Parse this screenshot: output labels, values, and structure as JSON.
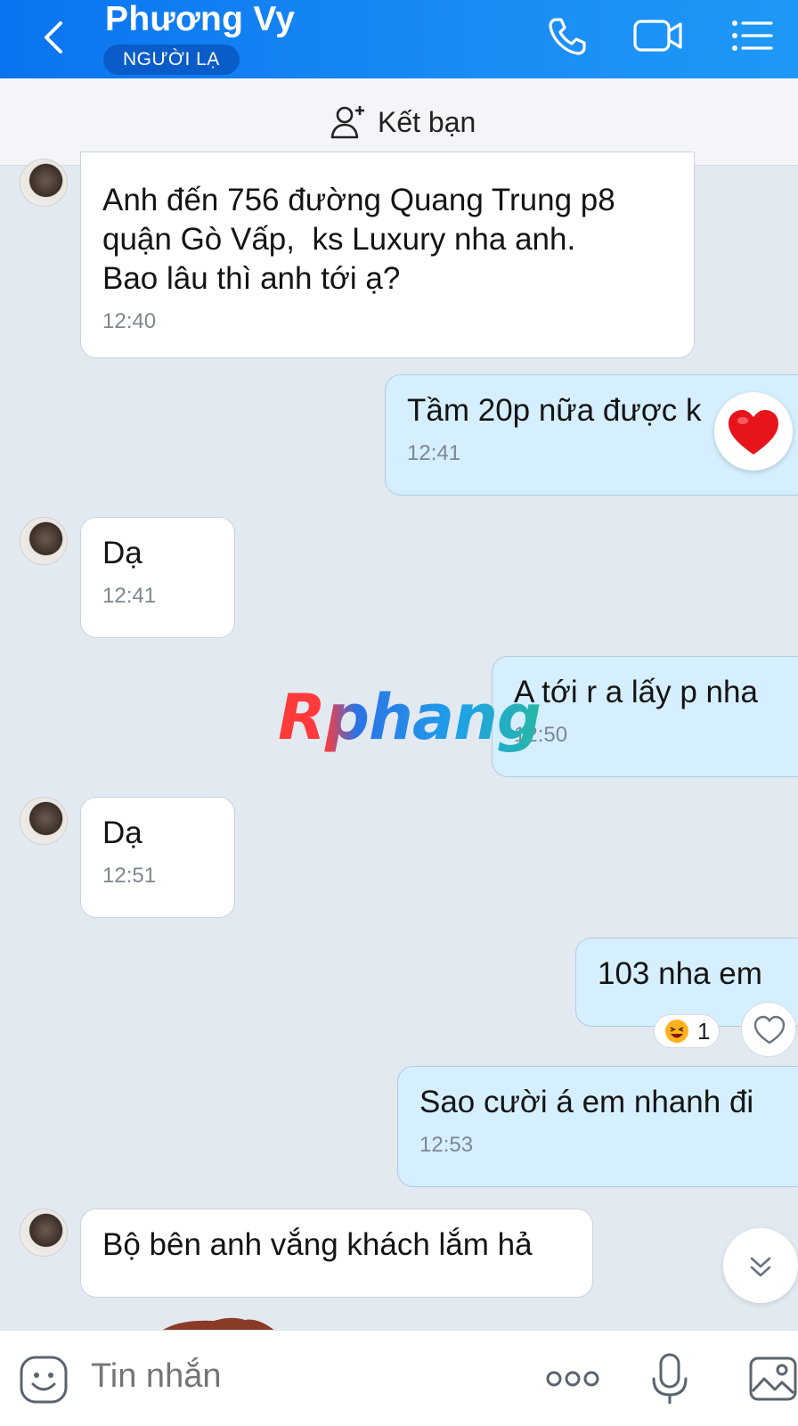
{
  "header": {
    "contact_name": "Phương Vy",
    "badge": "NGƯỜI LẠ",
    "icons": [
      "chevron-left-icon",
      "phone-icon",
      "video-call-icon",
      "list-menu-icon"
    ]
  },
  "friend_bar": {
    "label": "Kết bạn"
  },
  "messages": [
    {
      "from": "contact",
      "text": "Anh đến 756 đường Quang Trung p8\nquận Gò Vấp,  ks Luxury nha anh.\nBao lâu thì anh tới ạ?",
      "time": "12:40"
    },
    {
      "from": "me",
      "text": "Tầm 20p nữa được k",
      "time": "12:41",
      "reaction": "heart"
    },
    {
      "from": "contact",
      "text": "Dạ",
      "time": "12:41"
    },
    {
      "from": "me",
      "text": "A tới r a lấy p nha",
      "time": "12:50"
    },
    {
      "from": "contact",
      "text": "Dạ",
      "time": "12:51"
    },
    {
      "from": "me",
      "text": "103 nha em",
      "reaction_count": "1"
    },
    {
      "from": "me",
      "text": "Sao cười á em nhanh đi",
      "time": "12:53"
    },
    {
      "from": "contact",
      "text": "Bộ bên anh vắng khách lắm hả"
    }
  ],
  "watermark": "Rphang",
  "input": {
    "placeholder": "Tin nhắn"
  },
  "colors": {
    "header": "#0a74f0",
    "outgoing_bubble": "#d5efff",
    "background": "#e2e9f1"
  }
}
